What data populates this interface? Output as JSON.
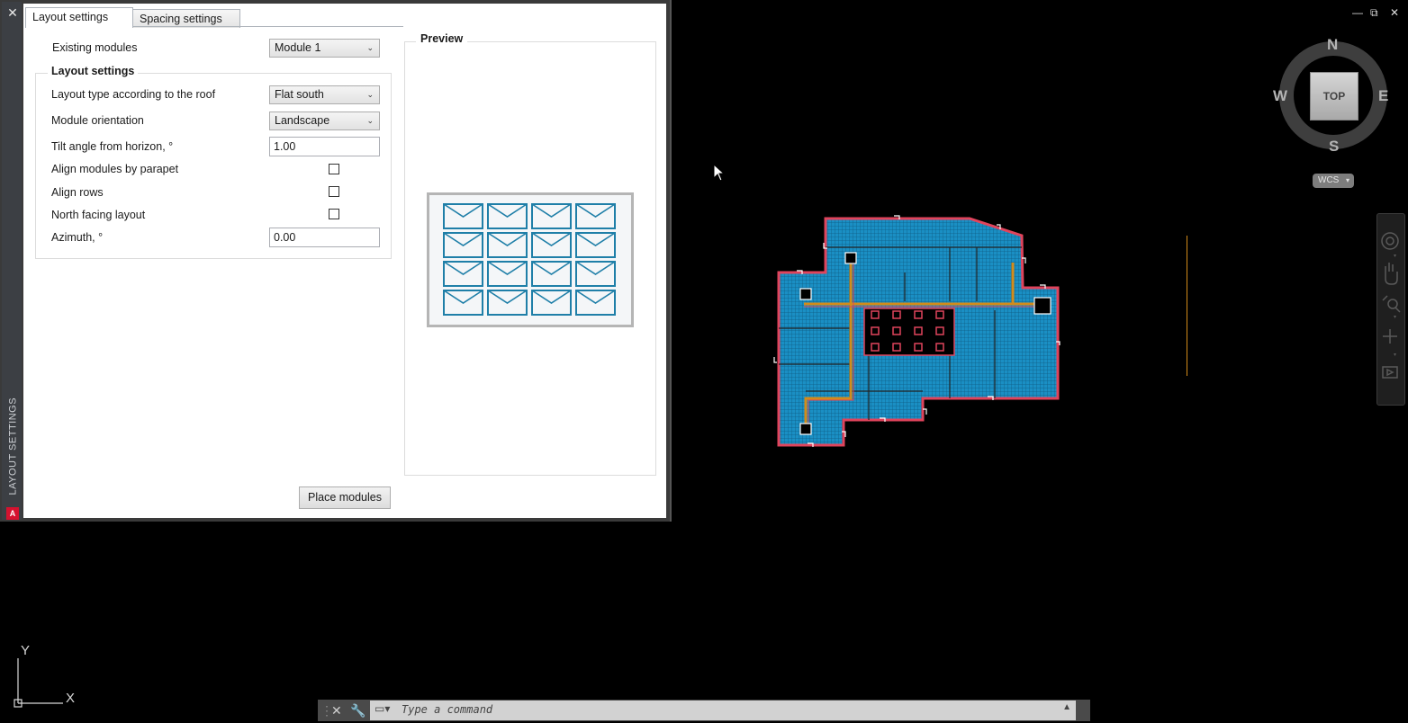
{
  "palette": {
    "title": "LAYOUT SETTINGS",
    "close_glyph": "✕",
    "app_logo_letter": "A",
    "tabs": [
      {
        "label": "Layout settings",
        "active": true
      },
      {
        "label": "Spacing settings",
        "active": false
      }
    ],
    "existing_modules": {
      "label": "Existing modules",
      "value": "Module 1"
    },
    "group_title": "Layout settings",
    "fields": {
      "layout_type": {
        "label": "Layout type according to the roof",
        "value": "Flat south"
      },
      "module_orientation": {
        "label": "Module orientation",
        "value": "Landscape"
      },
      "tilt_angle": {
        "label": "Tilt angle from horizon, °",
        "value": "1.00"
      },
      "align_parapet": {
        "label": "Align modules by parapet",
        "checked": false
      },
      "align_rows": {
        "label": "Align rows",
        "checked": false
      },
      "north_facing": {
        "label": "North facing layout",
        "checked": false
      },
      "azimuth": {
        "label": "Azimuth, °",
        "value": "0.00"
      }
    },
    "preview_title": "Preview",
    "place_button": "Place modules"
  },
  "viewcube": {
    "north": "N",
    "south": "S",
    "east": "E",
    "west": "W",
    "face": "TOP",
    "wcs": "WCS"
  },
  "ucs": {
    "x_label": "X",
    "y_label": "Y"
  },
  "command_line": {
    "placeholder": "Type a command"
  },
  "colors": {
    "roof_fill": "#1a8fc4",
    "roof_outline": "#e0445c",
    "cable": "#d38b1a",
    "preview_module": "#1f7fa8",
    "canvas": "#000000"
  }
}
